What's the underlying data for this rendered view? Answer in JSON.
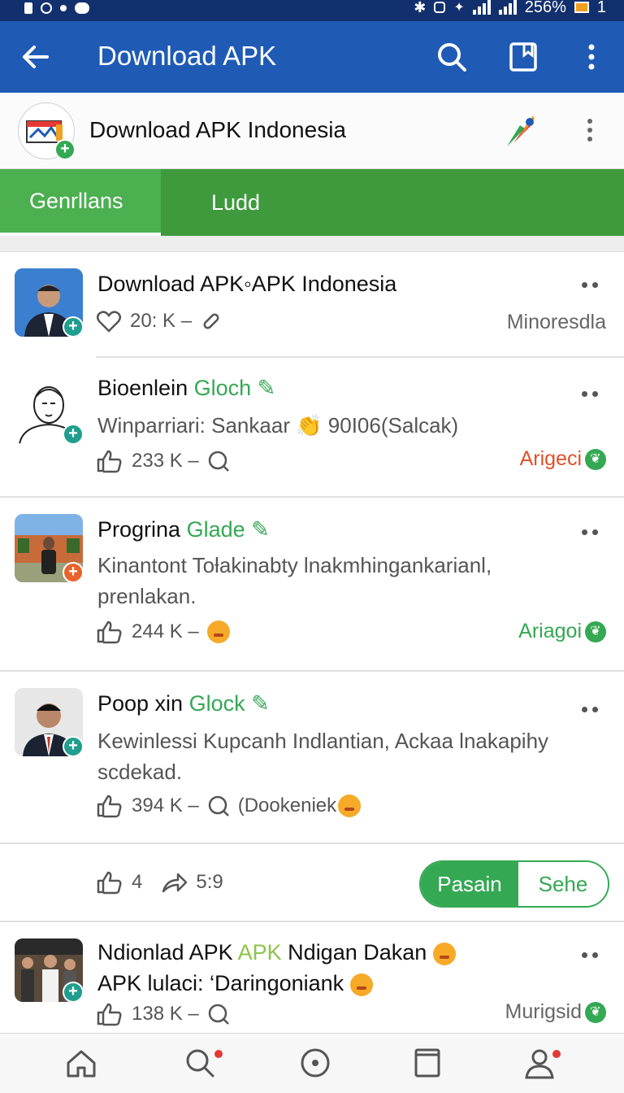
{
  "status_bar": {
    "battery": "256%",
    "sim": "1"
  },
  "app_bar": {
    "title": "Download APK",
    "icons": [
      "back-arrow-icon",
      "search-icon",
      "bookmark-icon",
      "more-vert-icon"
    ]
  },
  "channel": {
    "name": "Download APK Indonesia",
    "logo": "brand-logo-icon"
  },
  "tabs": [
    {
      "label": "Genrllans",
      "active": true
    },
    {
      "label": "Ludd",
      "active": false
    }
  ],
  "posts": [
    {
      "title": "Download APK◦APK Indonesia",
      "meta_count": "20: K –",
      "right_text": "Minoresdla"
    },
    {
      "title_main": "Bioenlein ",
      "title_green": "Gloch",
      "text": "Winparriari: Sankaar 👏 90I06(Salcak)",
      "meta_count": "233 K –",
      "right_text": "Arigeci"
    },
    {
      "title_main": "Progrina ",
      "title_green": "Glade",
      "text": "Kinantont Toƚakinabty lnakmhingankarianl, prenlakan.",
      "meta_count": "244 K –",
      "right_text": "Ariagoi"
    },
    {
      "title_main": "Poop xin ",
      "title_green": "Glock",
      "text": "Kewinlessi Kupcanh Indlantian, Ackaa lnakapihy scdekad.",
      "meta_count": "394 K –",
      "meta_extra": "(Dookeniek"
    },
    {
      "like_count": "4",
      "share_count": "5:9",
      "toggle_on": "Pasain",
      "toggle_off": "Sehe"
    },
    {
      "title_main": "Ndionlad APK ",
      "title_green": "APK",
      "title_rest": " Ndigan Dakan",
      "line2": "APK lulaci: ‘Daringoniank",
      "meta_count": "138 K –",
      "right_text": "Murigsid"
    }
  ],
  "colors": {
    "appbar": "#1f5bb5",
    "statusbar": "#12306e",
    "tab_bar": "#3f9a3d",
    "accent_green": "#34a853",
    "orange_label": "#e0502a"
  },
  "bottom_nav": [
    "home-icon",
    "search-icon",
    "discover-icon",
    "library-icon",
    "profile-icon"
  ]
}
